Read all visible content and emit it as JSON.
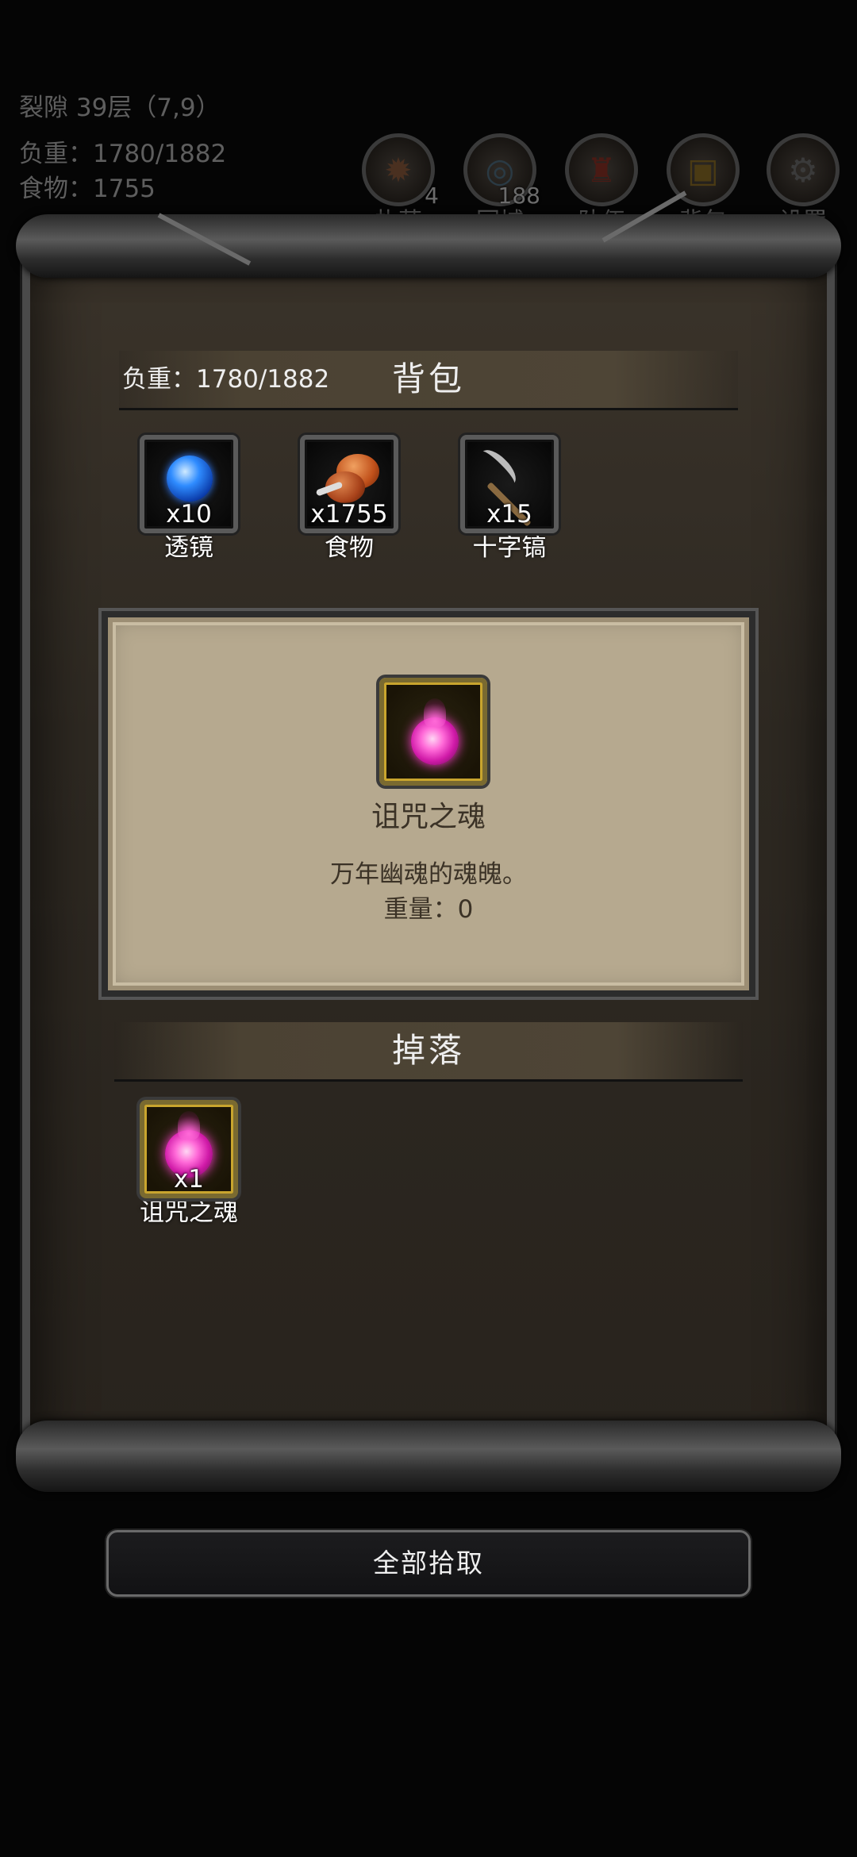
{
  "hud": {
    "location": "裂隙 39层（7,9）",
    "load": "负重：1780/1882",
    "food": "食物：1755",
    "buttons": [
      {
        "label": "扎营",
        "count": "4",
        "icon": "campfire-icon"
      },
      {
        "label": "回城",
        "count": "188",
        "icon": "portal-icon"
      },
      {
        "label": "队伍",
        "count": "",
        "icon": "team-icon"
      },
      {
        "label": "背包",
        "count": "",
        "icon": "backpack-icon"
      },
      {
        "label": "设置",
        "count": "",
        "icon": "gear-icon"
      }
    ]
  },
  "backpack": {
    "load": "负重：1780/1882",
    "title": "背包",
    "items": [
      {
        "qty": "x10",
        "name": "透镜",
        "icon": "lens-orb-icon"
      },
      {
        "qty": "x1755",
        "name": "食物",
        "icon": "meat-food-icon"
      },
      {
        "qty": "x15",
        "name": "十字镐",
        "icon": "pickaxe-icon"
      }
    ]
  },
  "detail": {
    "name": "诅咒之魂",
    "description": "万年幽魂的魂魄。",
    "weight": "重量：0",
    "icon": "cursed-soul-icon"
  },
  "drops": {
    "title": "掉落",
    "items": [
      {
        "qty": "x1",
        "name": "诅咒之魂",
        "icon": "cursed-soul-icon"
      }
    ]
  },
  "pick_all_label": "全部拾取",
  "colors": {
    "frame_bg": "#2e2922",
    "detail_bg": "#b6a98f",
    "soul_glow": "#ff3fcf",
    "lens_blue": "#2f8cff"
  }
}
